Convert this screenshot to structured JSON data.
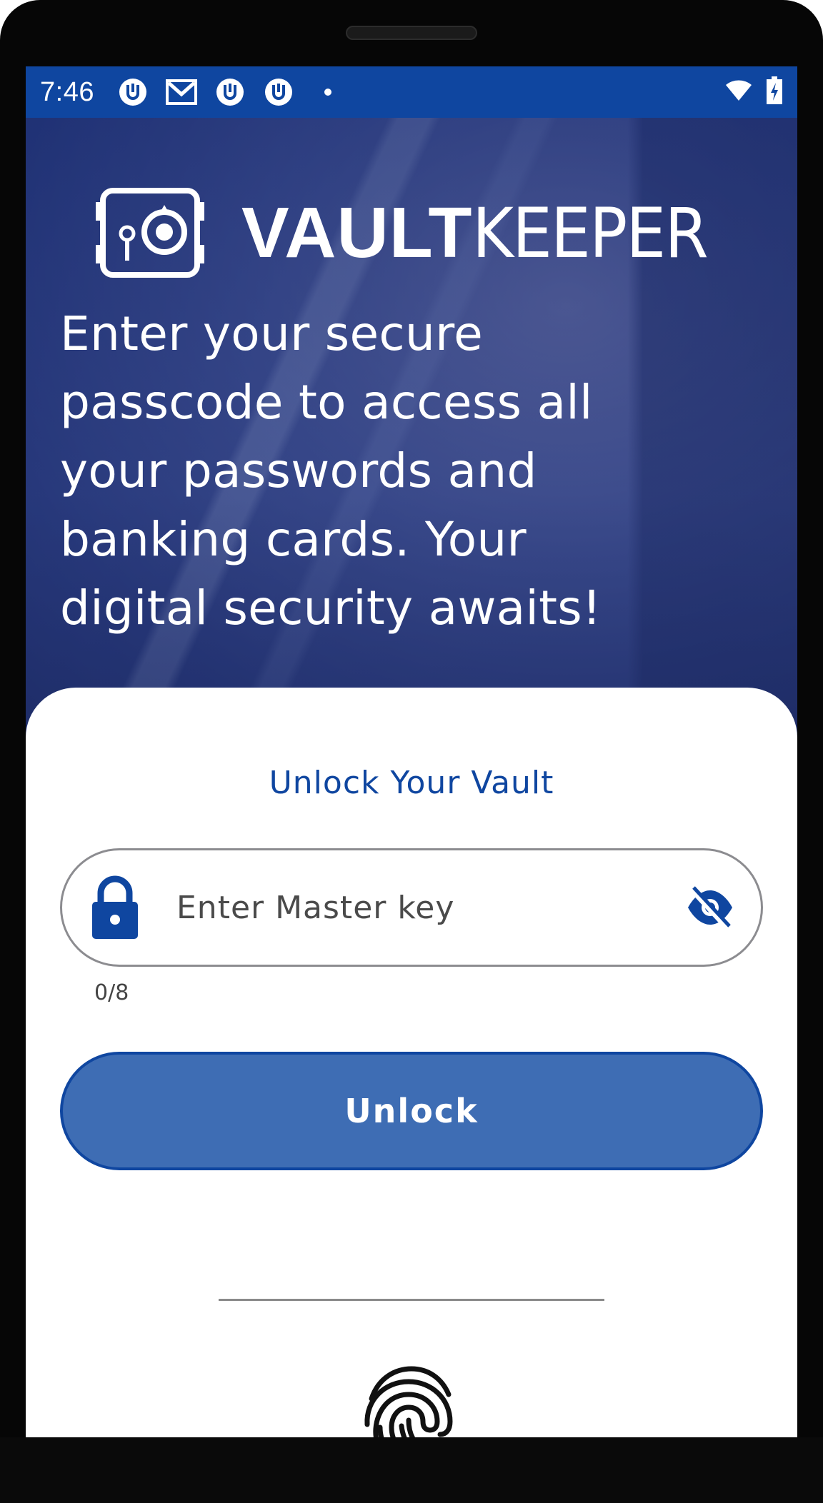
{
  "status_bar": {
    "time": "7:46",
    "icons": [
      "app-notification-icon",
      "gmail-icon",
      "app-notification-icon",
      "app-notification-icon",
      "notification-dot"
    ],
    "right_icons": [
      "wifi-icon",
      "battery-charging-icon"
    ]
  },
  "brand": {
    "name_bold": "VAULT",
    "name_light": "KEEPER"
  },
  "hero": {
    "tagline": "Enter your secure passcode to access all your passwords and banking cards. Your digital security awaits!"
  },
  "unlock_card": {
    "title": "Unlock Your Vault",
    "input_placeholder": "Enter Master key",
    "input_value": "",
    "counter": "0/8",
    "unlock_label": "Unlock"
  },
  "colors": {
    "primary": "#0f46a0",
    "button_fill": "#3e6db4",
    "input_border": "#8c8c90"
  }
}
